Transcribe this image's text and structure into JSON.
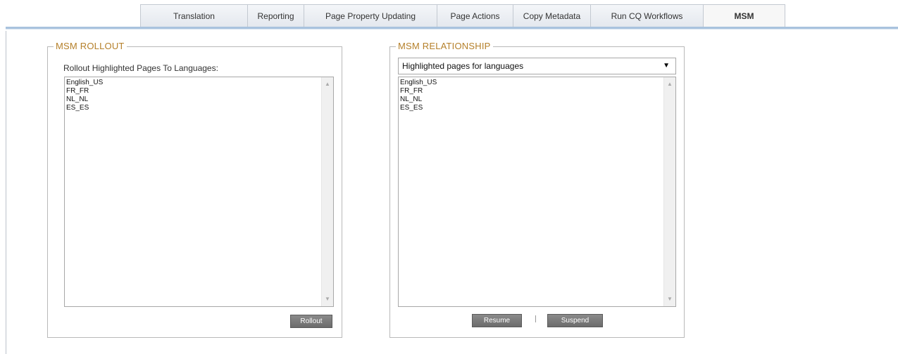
{
  "tabs": [
    {
      "label": "Translation"
    },
    {
      "label": "Reporting"
    },
    {
      "label": "Page Property Updating"
    },
    {
      "label": "Page Actions"
    },
    {
      "label": "Copy Metadata"
    },
    {
      "label": "Run CQ Workflows"
    },
    {
      "label": "MSM",
      "active": true
    }
  ],
  "rollout": {
    "legend": "MSM ROLLOUT",
    "label": "Rollout Highlighted Pages To Languages:",
    "languages": [
      "English_US",
      "FR_FR",
      "NL_NL",
      "ES_ES"
    ],
    "button_label": "Rollout"
  },
  "relationship": {
    "legend": "MSM RELATIONSHIP",
    "select_value": "Highlighted pages for languages",
    "languages": [
      "English_US",
      "FR_FR",
      "NL_NL",
      "ES_ES"
    ],
    "resume_label": "Resume",
    "suspend_label": "Suspend"
  },
  "icons": {
    "up": "scroll-up-arrow",
    "down": "scroll-down-arrow",
    "dropdown": "dropdown-caret"
  }
}
